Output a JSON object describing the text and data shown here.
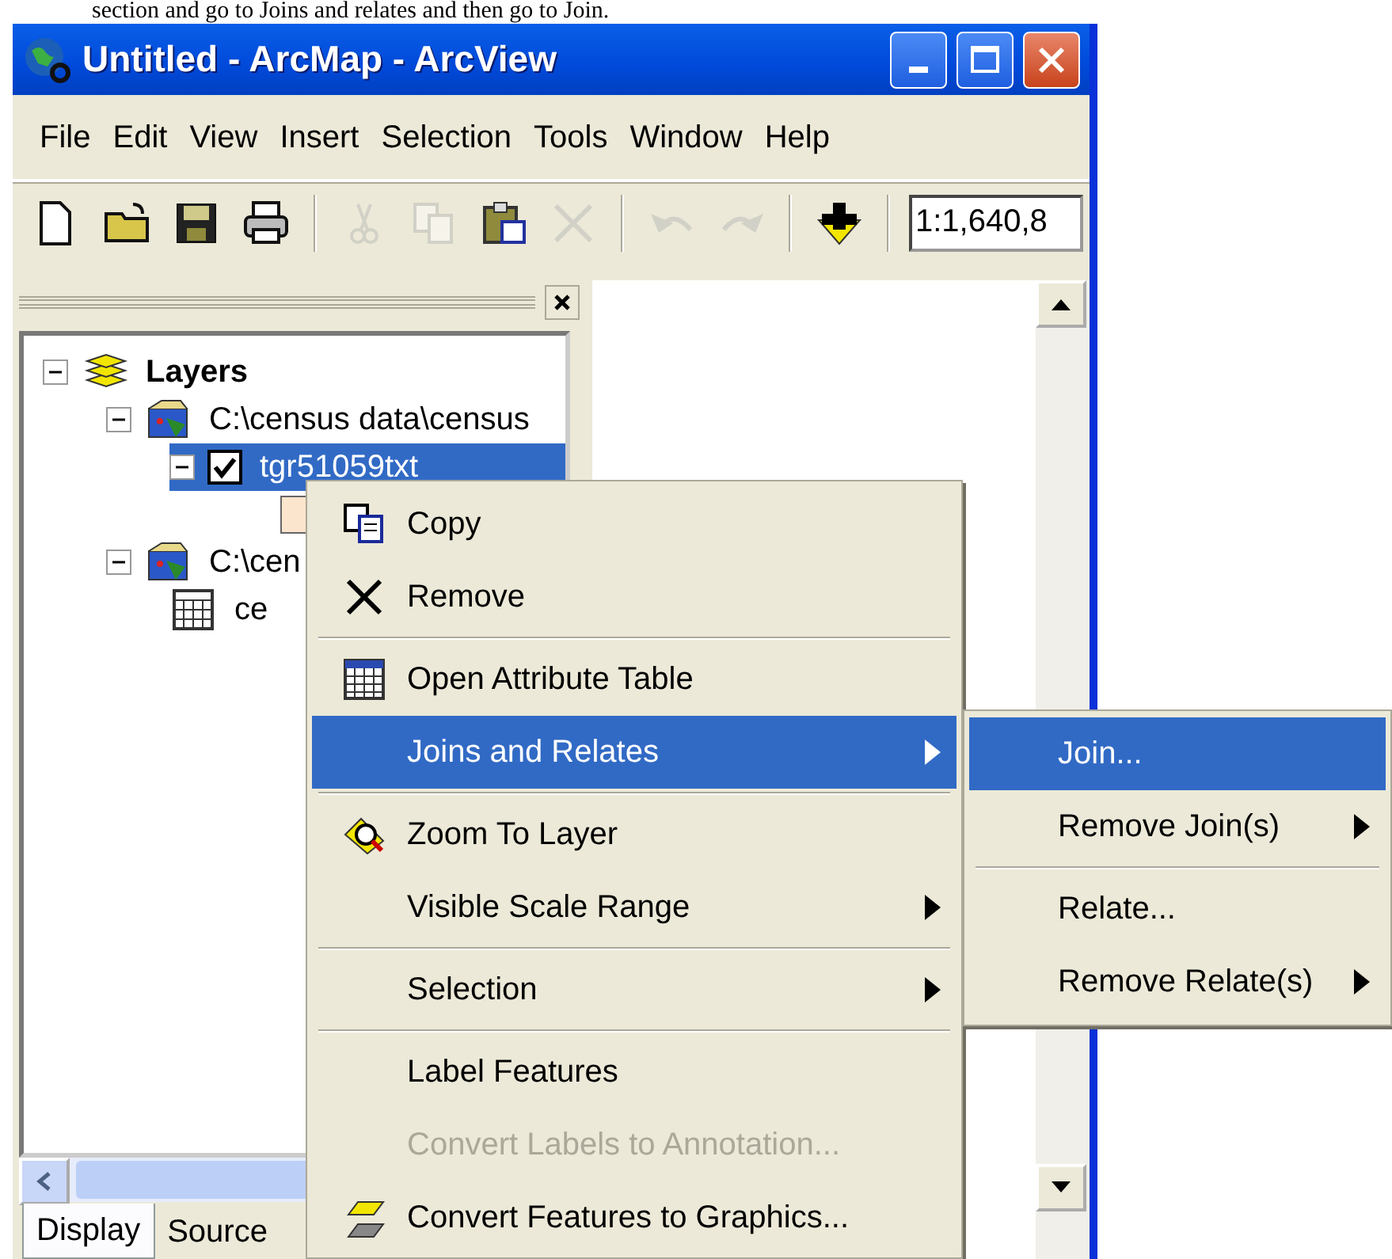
{
  "caption": "section and go to Joins and relates and then go to Join.",
  "window": {
    "title": "Untitled - ArcMap - ArcView"
  },
  "menu": [
    "File",
    "Edit",
    "View",
    "Insert",
    "Selection",
    "Tools",
    "Window",
    "Help"
  ],
  "toolbar": {
    "buttons": [
      {
        "kind": "new",
        "disabled": false
      },
      {
        "kind": "open",
        "disabled": false
      },
      {
        "kind": "save",
        "disabled": false
      },
      {
        "kind": "print",
        "disabled": false
      },
      {
        "kind": "separator"
      },
      {
        "kind": "cut",
        "disabled": true
      },
      {
        "kind": "copy",
        "disabled": true
      },
      {
        "kind": "paste",
        "disabled": false
      },
      {
        "kind": "delete",
        "disabled": true
      },
      {
        "kind": "separator"
      },
      {
        "kind": "undo",
        "disabled": true
      },
      {
        "kind": "redo",
        "disabled": true
      },
      {
        "kind": "separator"
      },
      {
        "kind": "add",
        "disabled": false
      },
      {
        "kind": "separator"
      }
    ],
    "scale": "1:1,640,8"
  },
  "toc": {
    "items": [
      {
        "kind": "frame",
        "label": "Layers",
        "expanded": true,
        "children": [
          {
            "kind": "workspace",
            "label": "C:\\census data\\census",
            "expanded": true,
            "children": [
              {
                "kind": "layer",
                "label": "tgr51059txt",
                "checked": true,
                "selected": true,
                "expanded": true,
                "children": [
                  {
                    "kind": "symbol"
                  }
                ]
              }
            ]
          },
          {
            "kind": "workspace",
            "label": "C:\\cen",
            "expanded": true,
            "children": [
              {
                "kind": "table",
                "label": "ce"
              }
            ]
          }
        ]
      }
    ],
    "tabs": [
      {
        "label": "Display",
        "selected": true
      },
      {
        "label": "Source",
        "selected": false
      }
    ]
  },
  "context_menu": {
    "items": [
      {
        "kind": "copy",
        "label": "Copy",
        "selected": false,
        "disabled": false,
        "submenu": false
      },
      {
        "kind": "remove",
        "label": "Remove",
        "selected": false,
        "disabled": false,
        "submenu": false
      },
      {
        "kind": "separator"
      },
      {
        "kind": "table",
        "label": "Open Attribute Table",
        "selected": false,
        "disabled": false,
        "submenu": false
      },
      {
        "kind": "plain",
        "label": "Joins and Relates",
        "selected": true,
        "disabled": false,
        "submenu": true
      },
      {
        "kind": "separator"
      },
      {
        "kind": "zoom",
        "label": "Zoom To Layer",
        "selected": false,
        "disabled": false,
        "submenu": false
      },
      {
        "kind": "plain",
        "label": "Visible Scale Range",
        "selected": false,
        "disabled": false,
        "submenu": true
      },
      {
        "kind": "separator"
      },
      {
        "kind": "plain",
        "label": "Selection",
        "selected": false,
        "disabled": false,
        "submenu": true
      },
      {
        "kind": "separator"
      },
      {
        "kind": "plain",
        "label": "Label Features",
        "selected": false,
        "disabled": false,
        "submenu": false
      },
      {
        "kind": "plain",
        "label": "Convert Labels to Annotation...",
        "selected": false,
        "disabled": true,
        "submenu": false
      },
      {
        "kind": "convert",
        "label": "Convert Features to Graphics...",
        "selected": false,
        "disabled": false,
        "submenu": false
      }
    ]
  },
  "submenu": {
    "items": [
      {
        "kind": "plain",
        "label": "Join...",
        "selected": true,
        "submenu": false
      },
      {
        "kind": "plain",
        "label": "Remove Join(s)",
        "selected": false,
        "submenu": true
      },
      {
        "kind": "separator"
      },
      {
        "kind": "plain",
        "label": "Relate...",
        "selected": false,
        "submenu": false
      },
      {
        "kind": "plain",
        "label": "Remove Relate(s)",
        "selected": false,
        "submenu": true
      }
    ]
  }
}
